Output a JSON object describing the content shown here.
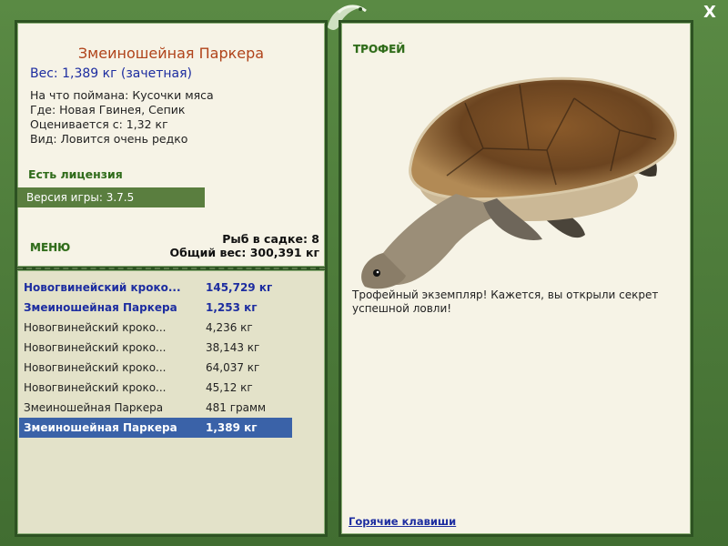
{
  "window": {
    "close_label": "X"
  },
  "fish": {
    "title": "Змеиношейная Паркера",
    "weight": "Вес: 1,389 кг (зачетная)",
    "bait": "На что поймана: Кусочки мяса",
    "location": "Где: Новая Гвинея, Сепик",
    "valued_from": "Оценивается с: 1,32 кг",
    "rarity": "Вид: Ловится очень редко"
  },
  "license": "Есть лицензия",
  "version": "Версия игры: 3.7.5",
  "menu_label": "МЕНЮ",
  "stats": {
    "fish_in_keepnet": "Рыб в садке: 8",
    "total_weight": "Общий вес: 300,391 кг"
  },
  "catches": [
    {
      "name": "Новогвинейский кроко...",
      "weight": "145,729 кг",
      "style": "bold"
    },
    {
      "name": "Змеиношейная Паркера",
      "weight": "1,253 кг",
      "style": "bold"
    },
    {
      "name": "Новогвинейский кроко...",
      "weight": "4,236 кг",
      "style": "normal"
    },
    {
      "name": "Новогвинейский кроко...",
      "weight": "38,143 кг",
      "style": "normal"
    },
    {
      "name": "Новогвинейский кроко...",
      "weight": "64,037 кг",
      "style": "normal"
    },
    {
      "name": "Новогвинейский кроко...",
      "weight": "45,12 кг",
      "style": "normal"
    },
    {
      "name": "Змеиношейная Паркера",
      "weight": "481 грамм",
      "style": "normal"
    },
    {
      "name": "Змеиношейная Паркера",
      "weight": "1,389 кг",
      "style": "selected"
    }
  ],
  "trophy": {
    "label": "ТРОФЕЙ",
    "text": "Трофейный экземпляр! Кажется, вы открыли секрет успешной ловли!"
  },
  "hotkeys_label": "Горячие клавиши",
  "colors": {
    "frame_green": "#4d7a3a",
    "title_orange": "#b0431a",
    "link_blue": "#1d2da0",
    "selection_blue": "#3a62a8"
  }
}
